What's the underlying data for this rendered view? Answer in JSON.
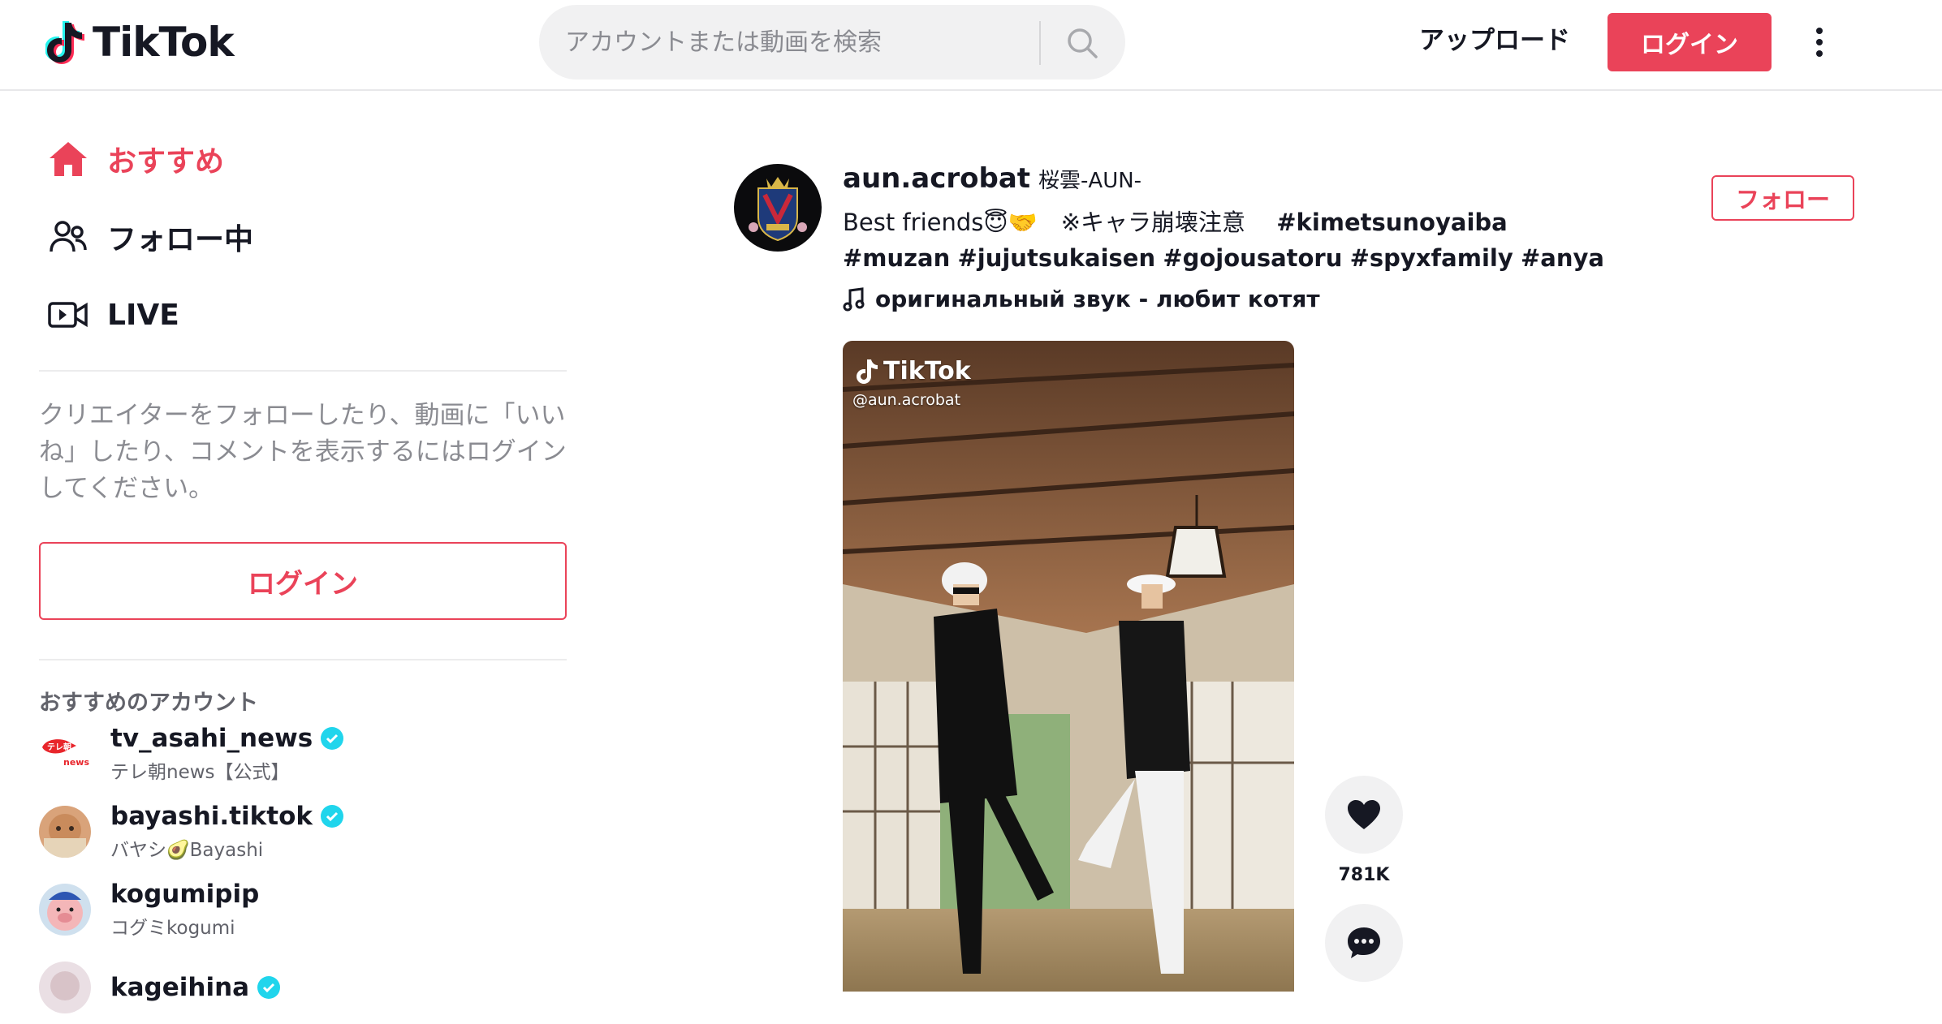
{
  "header": {
    "logo_text": "TikTok",
    "search_placeholder": "アカウントまたは動画を検索",
    "upload_label": "アップロード",
    "login_label": "ログイン"
  },
  "sidebar": {
    "nav": [
      {
        "label": "おすすめ",
        "icon": "home-icon"
      },
      {
        "label": "フォロー中",
        "icon": "users-icon"
      },
      {
        "label": "LIVE",
        "icon": "live-camera-icon"
      }
    ],
    "login_hint": "クリエイターをフォローしたり、動画に「いいね」したり、コメントを表示するにはログインしてください。",
    "login_button": "ログイン",
    "suggested_title": "おすすめのアカウント",
    "accounts": [
      {
        "name": "tv_asahi_news",
        "sub": "テレ朝news【公式】",
        "verified": true
      },
      {
        "name": "bayashi.tiktok",
        "sub": "バヤシ🥑Bayashi",
        "verified": true
      },
      {
        "name": "kogumipip",
        "sub": "コグミkogumi",
        "verified": false
      },
      {
        "name": "kageihina",
        "sub": "",
        "verified": true
      }
    ]
  },
  "post": {
    "author_id": "aun.acrobat",
    "author_nick": "桜雲-AUN-",
    "caption_text": "Best friends😇🤝　※キャラ崩壊注意　",
    "hashtags": [
      "#kimetsunoyaiba",
      "#muzan",
      "#jujutsukaisen",
      "#gojousatoru",
      "#spyxfamily",
      "#anya"
    ],
    "music": "оригинальный звук - любит котят",
    "follow_label": "フォロー",
    "video_watermark": "TikTok",
    "video_handle": "@aun.acrobat",
    "like_count": "781K"
  },
  "colors": {
    "accent": "#ea4359",
    "verified": "#20d5ec",
    "text": "#161823",
    "muted": "#8a8b91"
  }
}
